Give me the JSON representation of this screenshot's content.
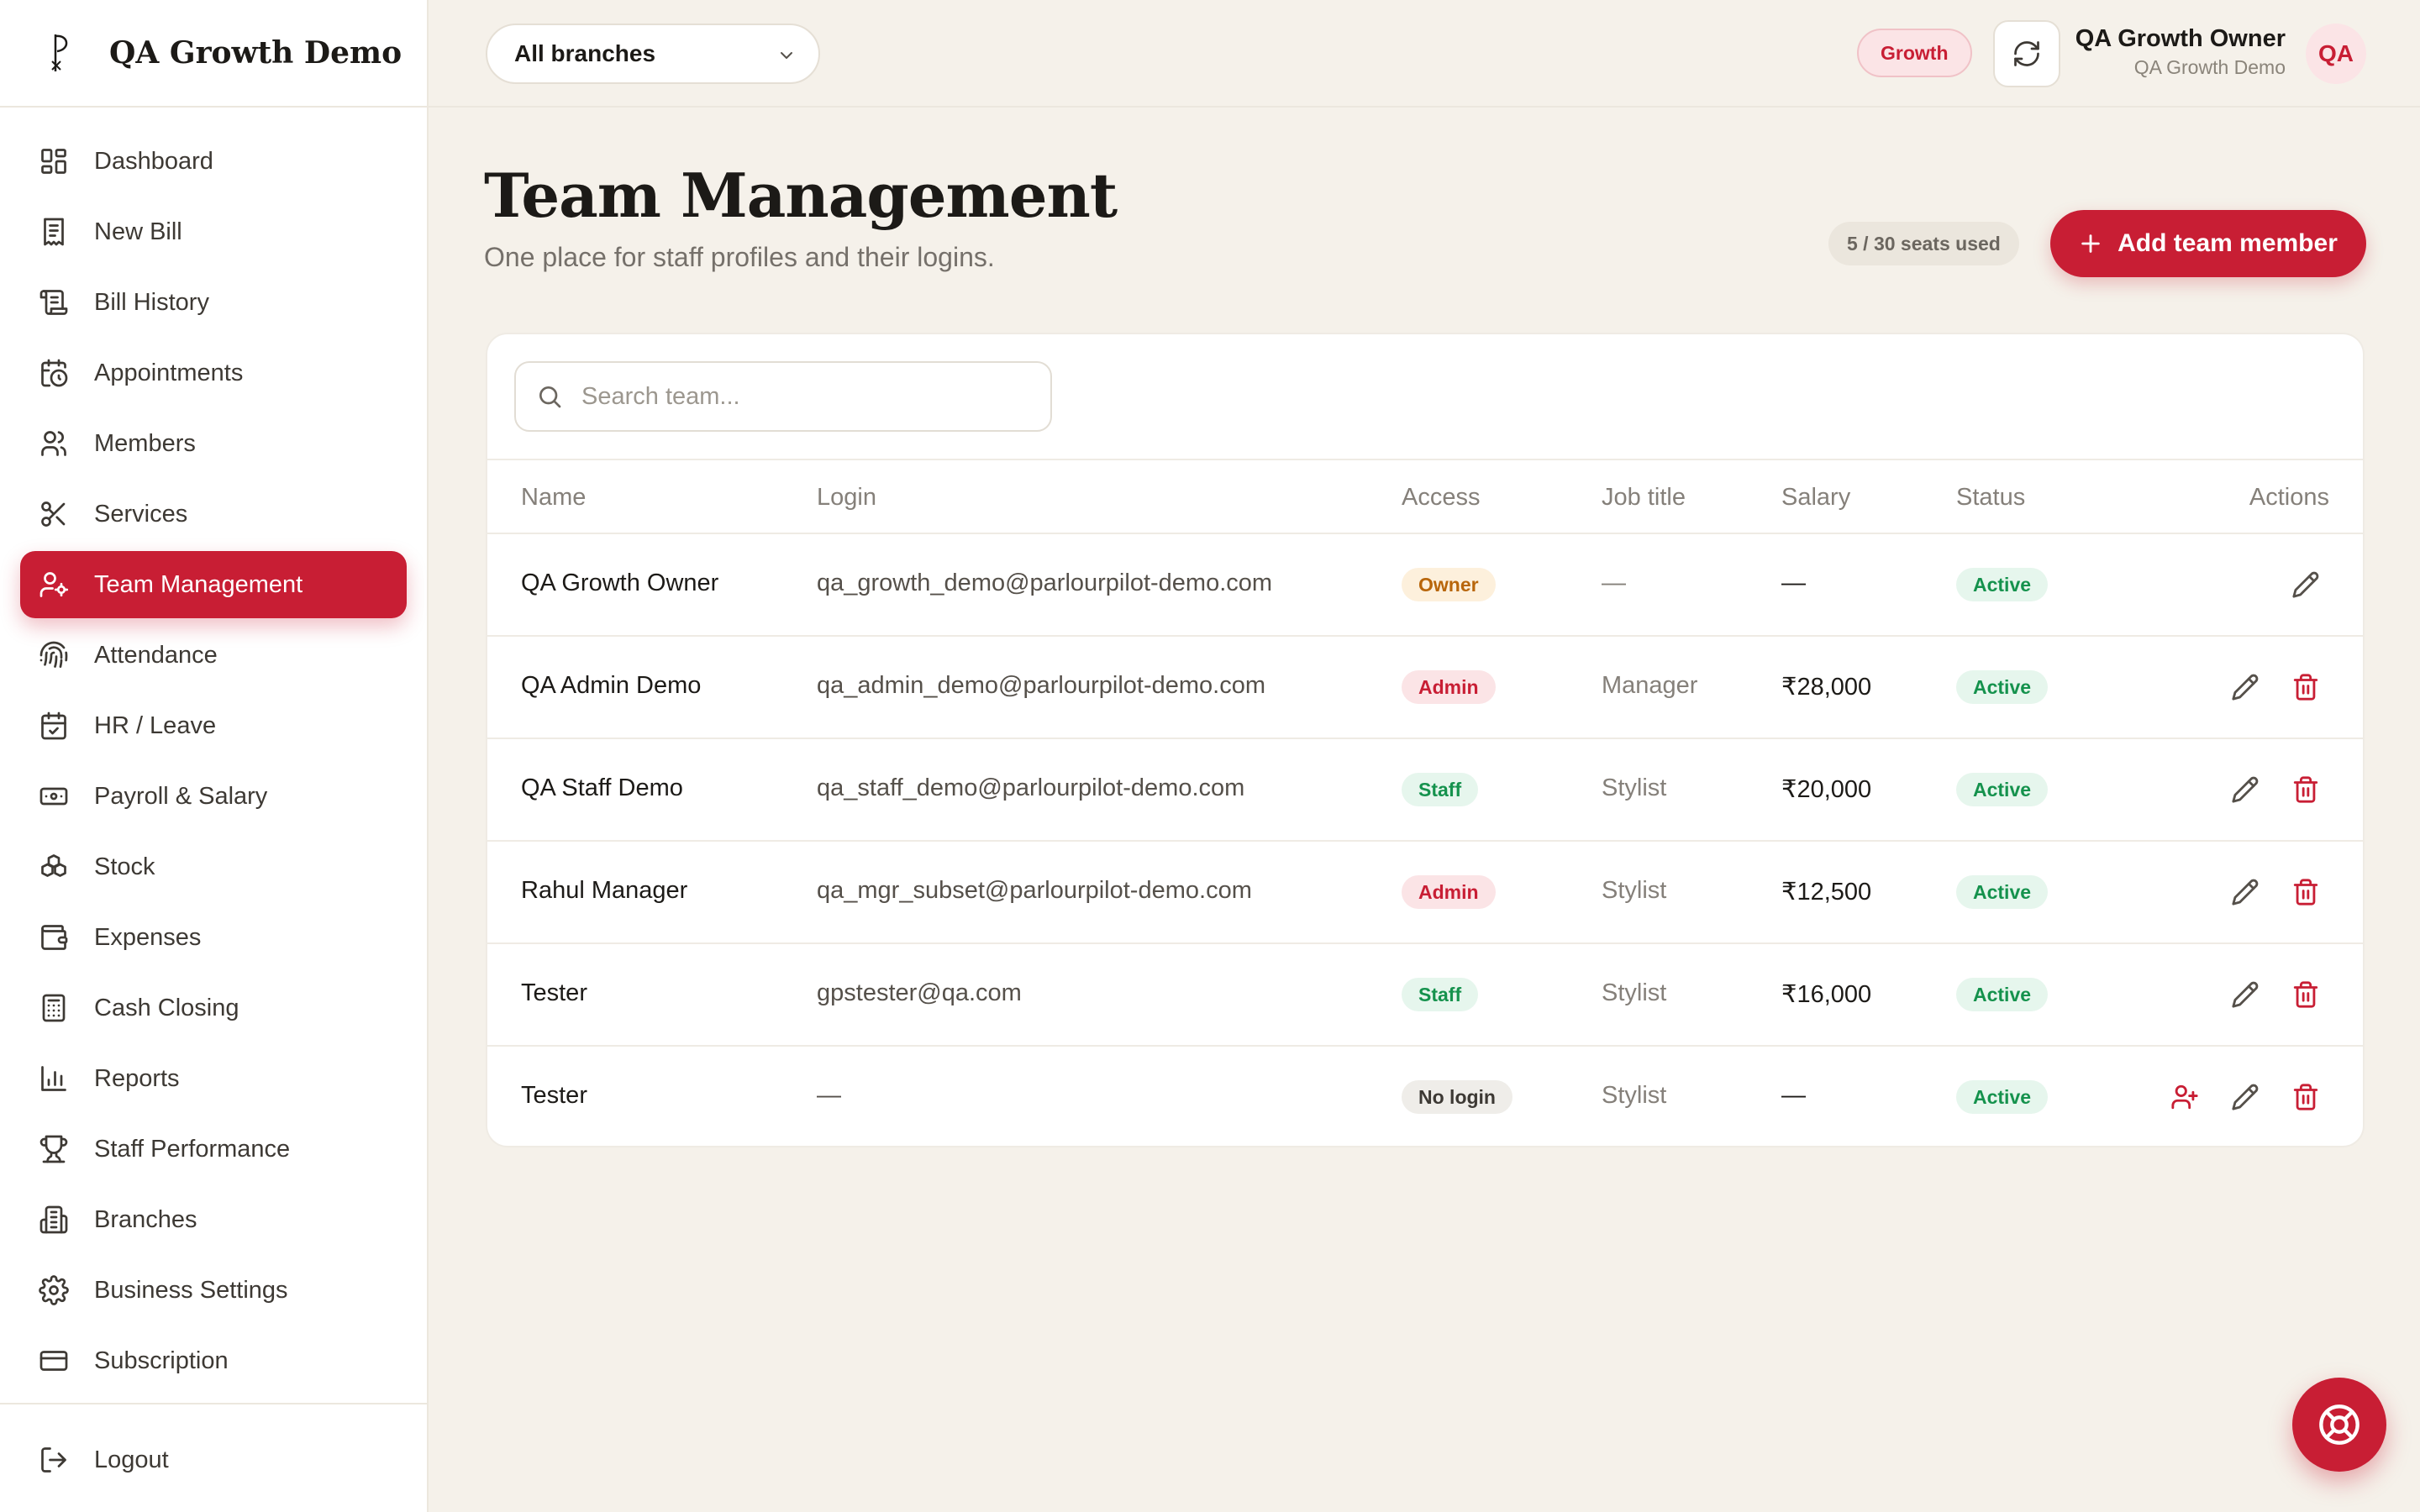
{
  "brand": {
    "name": "QA Growth Demo"
  },
  "sidebar": {
    "items": [
      {
        "label": "Dashboard",
        "icon": "dashboard-icon"
      },
      {
        "label": "New Bill",
        "icon": "new-bill-icon"
      },
      {
        "label": "Bill History",
        "icon": "bill-history-icon"
      },
      {
        "label": "Appointments",
        "icon": "calendar-clock-icon"
      },
      {
        "label": "Members",
        "icon": "members-icon"
      },
      {
        "label": "Services",
        "icon": "scissors-icon"
      },
      {
        "label": "Team Management",
        "icon": "user-cog-icon",
        "active": true
      },
      {
        "label": "Attendance",
        "icon": "fingerprint-icon"
      },
      {
        "label": "HR / Leave",
        "icon": "calendar-check-icon"
      },
      {
        "label": "Payroll & Salary",
        "icon": "banknote-icon"
      },
      {
        "label": "Stock",
        "icon": "boxes-icon"
      },
      {
        "label": "Expenses",
        "icon": "wallet-icon"
      },
      {
        "label": "Cash Closing",
        "icon": "calculator-icon"
      },
      {
        "label": "Reports",
        "icon": "bar-chart-icon"
      },
      {
        "label": "Staff Performance",
        "icon": "trophy-icon"
      },
      {
        "label": "Branches",
        "icon": "building-icon"
      },
      {
        "label": "Business Settings",
        "icon": "gear-icon"
      },
      {
        "label": "Subscription",
        "icon": "credit-card-icon"
      }
    ],
    "logout_label": "Logout"
  },
  "topbar": {
    "branch_selected": "All branches",
    "plan_badge": "Growth",
    "user_name": "QA Growth Owner",
    "user_org": "QA Growth Demo",
    "avatar_initials": "QA"
  },
  "page": {
    "title": "Team Management",
    "subtitle": "One place for staff profiles and their logins.",
    "seats_used": "5 / 30 seats used",
    "add_button": "Add team member"
  },
  "search": {
    "placeholder": "Search team..."
  },
  "table": {
    "headers": {
      "name": "Name",
      "login": "Login",
      "access": "Access",
      "job": "Job title",
      "salary": "Salary",
      "status": "Status",
      "actions": "Actions"
    },
    "rows": [
      {
        "name": "QA Growth Owner",
        "login": "qa_growth_demo@parlourpilot-demo.com",
        "access": "Owner",
        "job": "—",
        "salary": "—",
        "status": "Active"
      },
      {
        "name": "QA Admin Demo",
        "login": "qa_admin_demo@parlourpilot-demo.com",
        "access": "Admin",
        "job": "Manager",
        "salary": "₹28,000",
        "status": "Active"
      },
      {
        "name": "QA Staff Demo",
        "login": "qa_staff_demo@parlourpilot-demo.com",
        "access": "Staff",
        "job": "Stylist",
        "salary": "₹20,000",
        "status": "Active"
      },
      {
        "name": "Rahul Manager",
        "login": "qa_mgr_subset@parlourpilot-demo.com",
        "access": "Admin",
        "job": "Stylist",
        "salary": "₹12,500",
        "status": "Active"
      },
      {
        "name": "Tester",
        "login": "gpstester@qa.com",
        "access": "Staff",
        "job": "Stylist",
        "salary": "₹16,000",
        "status": "Active"
      },
      {
        "name": "Tester",
        "login": "—",
        "access": "No login",
        "job": "Stylist",
        "salary": "—",
        "status": "Active"
      }
    ]
  },
  "colors": {
    "accent": "#c81e34",
    "background": "#f5f1ea",
    "success": "#15924d"
  }
}
